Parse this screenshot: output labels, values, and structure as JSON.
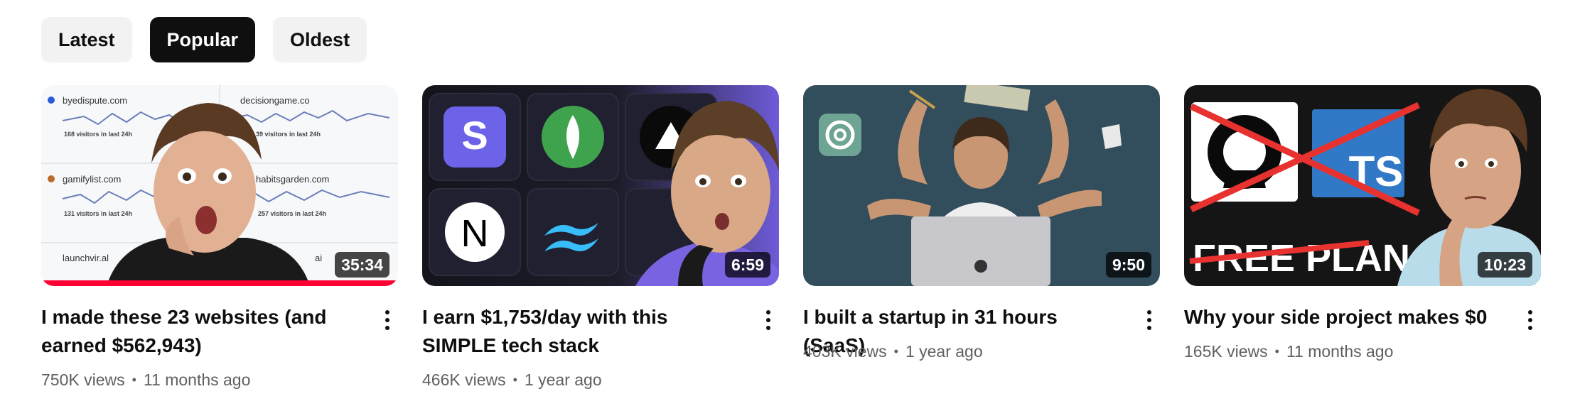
{
  "filters": [
    "Latest",
    "Popular",
    "Oldest"
  ],
  "active_filter": "Popular",
  "videos": [
    {
      "title": "I made these 23 websites (and earned $562,943)",
      "views": "750K views",
      "age": "11 months ago",
      "duration": "35:34",
      "watched_fraction": 1.0,
      "thumb_text": {
        "site1": "byedispute.com",
        "v1": "168 visitors in last 24h",
        "site2": "decisiongame.co",
        "v2": "39 visitors in last 24h",
        "site3": "gamifylist.com",
        "v3": "131 visitors in last 24h",
        "site4": "habitsgarden.com",
        "v4": "257 visitors in last 24h",
        "site5": "launchvir.al",
        "site6": "ai"
      }
    },
    {
      "title": "I earn $1,753/day with this SIMPLE tech stack",
      "views": "466K views",
      "age": "1 year ago",
      "duration": "6:59",
      "thumb_text": {
        "s": "S",
        "n": "N"
      }
    },
    {
      "title": "I built a startup in 31 hours (SaaS)",
      "views": "403K views",
      "age": "1 year ago",
      "duration": "9:50"
    },
    {
      "title": "Why your side project makes $0",
      "views": "165K views",
      "age": "11 months ago",
      "duration": "10:23",
      "thumb_text": {
        "ts": "TS",
        "free": "FREE PLAN"
      }
    }
  ],
  "colors": {
    "progress": "#ff0033",
    "chip_active_bg": "#0f0f0f",
    "chip_bg": "#f2f2f2",
    "meta": "#606060"
  }
}
